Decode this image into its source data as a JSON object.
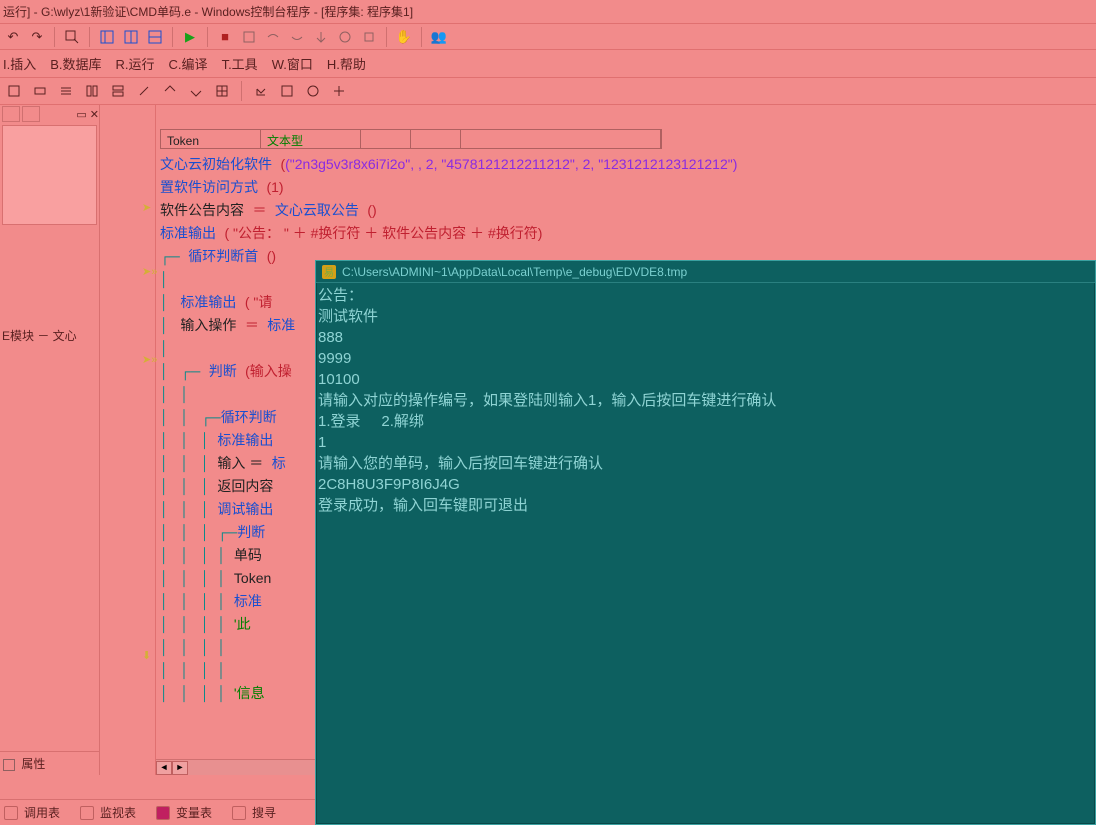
{
  "title": "运行] - G:\\wlyz\\1新验证\\CMD单码.e - Windows控制台程序 - [程序集: 程序集1]",
  "menus": [
    "I.插入",
    "B.数据库",
    "R.运行",
    "C.编译",
    "T.工具",
    "W.窗口",
    "H.帮助"
  ],
  "left": {
    "mod": "E模块 － 文心",
    "tab_props": "属性"
  },
  "code": {
    "token": "Token",
    "token_type": "文本型",
    "init": "文心云初始化软件",
    "init_args": "(\"2n3g5v3r8x6i7i2o\", , 2, \"4578121212211212\", 2, \"1231212123121212\")",
    "setaccess": "置软件访问方式",
    "setaccess_args": "(1)",
    "notice_var": "软件公告内容",
    "getnotice": "文心云取公告",
    "stdout": "标准输出",
    "stdout1_args": "( \"公告： \" ＋ #换行符 ＋ 软件公告内容 ＋ #换行符)",
    "loop_head": "循环判断首",
    "stdout2_arg1": "( \"请",
    "input_op": "输入操作",
    "stdfn": "标准",
    "judge": "判断",
    "judge_arg": "(输入操",
    "loop_judge": "循环判断",
    "stdout_lbl": "标准输出",
    "in_eq": "输入 ＝",
    "ret": "返回内容",
    "dbg": "调试输出",
    "judge2": "判断",
    "dan": "单码",
    "tok": "Token",
    "std_s": "标准",
    "quote_ci": "'此",
    "xin": "'信息"
  },
  "console": {
    "title": "C:\\Users\\ADMINI~1\\AppData\\Local\\Temp\\e_debug\\EDVDE8.tmp",
    "lines": [
      "公告：",
      "测试软件",
      "888",
      "9999",
      "10100",
      "请输入对应的操作编号，如果登陆则输入1，输入后按回车键进行确认",
      "1.登录     2.解绑",
      "1",
      "请输入您的单码，输入后按回车键进行确认",
      "2C8H8U3F9P8I6J4G",
      "登录成功，输入回车键即可退出"
    ]
  },
  "bottom": {
    "t1": "调用表",
    "t2": "监视表",
    "t3": "变量表",
    "t4": "搜寻"
  },
  "icons": {
    "undo": "↶",
    "redo": "↷",
    "run": "▶",
    "stop": "■"
  }
}
